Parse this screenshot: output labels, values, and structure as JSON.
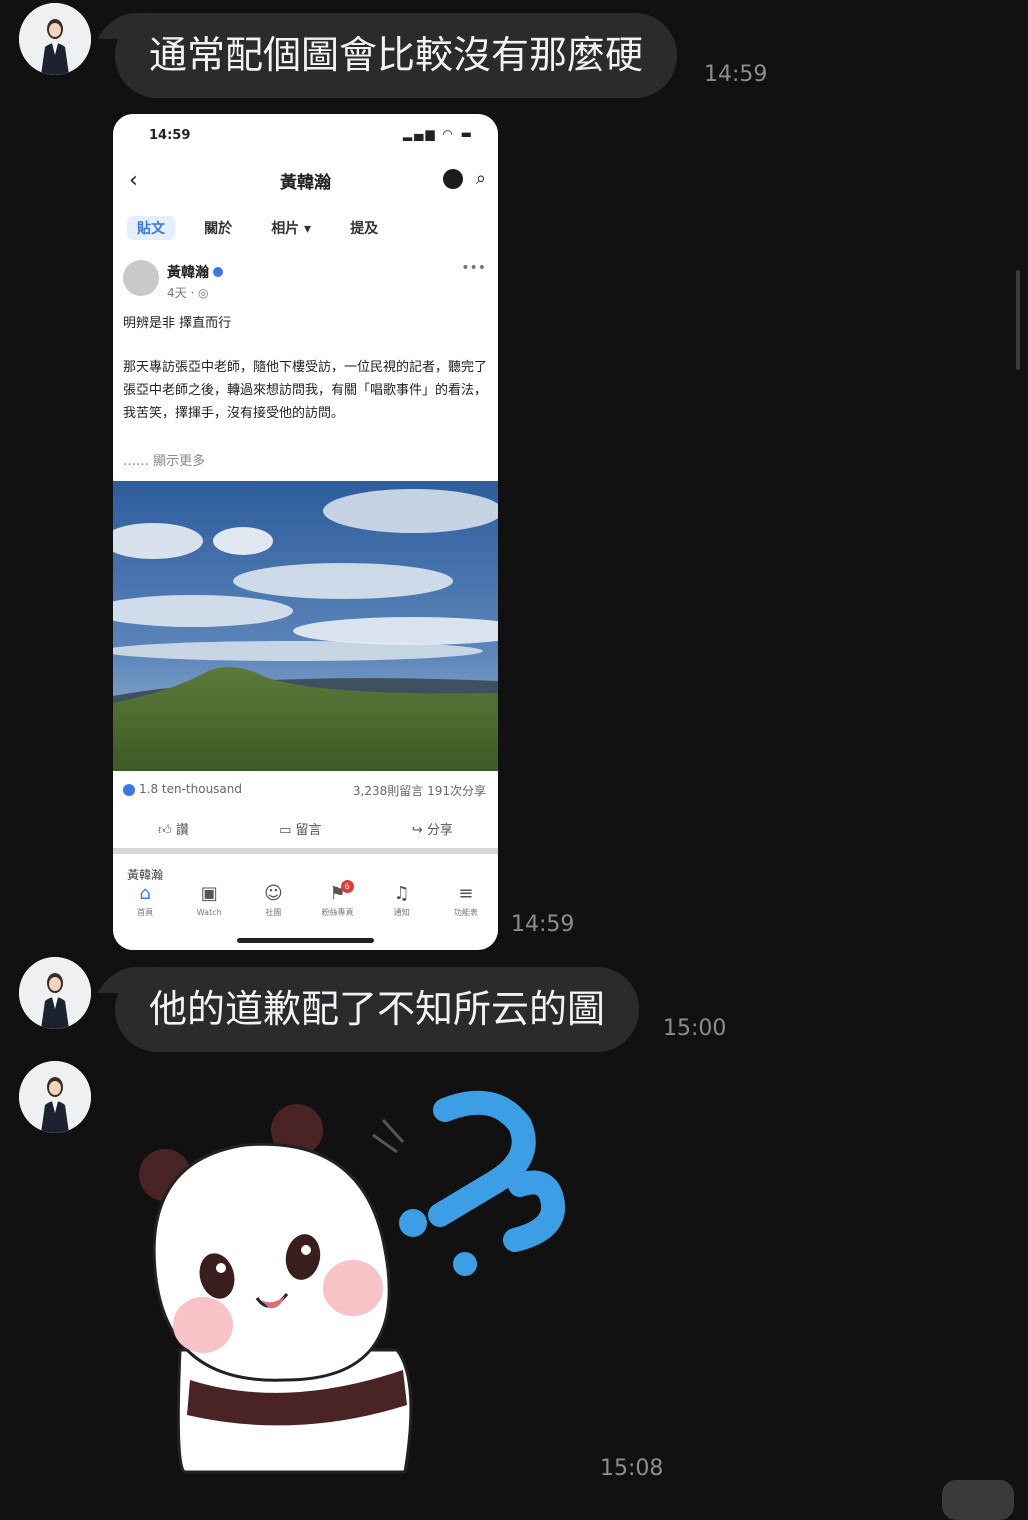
{
  "messages": [
    {
      "text": "通常配個圖會比較沒有那麼硬",
      "time": "14:59"
    },
    {
      "time": "14:59"
    },
    {
      "text": "他的道歉配了不知所云的圖",
      "time": "15:00"
    },
    {
      "time": "15:08"
    }
  ],
  "screenshot": {
    "status_time": "14:59",
    "page_name": "黃韓瀚",
    "tabs": [
      "貼文",
      "關於",
      "相片 ▾",
      "提及"
    ],
    "post": {
      "author": "黃韓瀚",
      "meta": "4天 · ◎",
      "title": "明辨是非 擇直而行",
      "body": "那天專訪張亞中老師，隨他下樓受訪，一位民視的記者，聽完了張亞中老師之後，轉過來想訪問我，有關「唱歌事件」的看法，我苦笑，擇揮手，沒有接受他的訪問。",
      "see_more": "…… 顯示更多",
      "reactions": "1.8 ten-thousand",
      "counts": "3,238則留言  191次分享",
      "actions": [
        "讚",
        "留言",
        "分享"
      ]
    },
    "next_post_author": "黃韓瀚",
    "nav": [
      {
        "icon": "⌂",
        "label": "首頁"
      },
      {
        "icon": "▣",
        "label": "Watch"
      },
      {
        "icon": "☺",
        "label": "社團"
      },
      {
        "icon": "⚑",
        "label": "粉絲專頁",
        "badge": "6"
      },
      {
        "icon": "♫",
        "label": "通知"
      },
      {
        "icon": "≡",
        "label": "功能表"
      }
    ]
  },
  "colors": {
    "background": "#111112",
    "bubble": "#2b2b2d",
    "accent": "#3b78e7",
    "sticker_question": "#3c9ee5"
  }
}
